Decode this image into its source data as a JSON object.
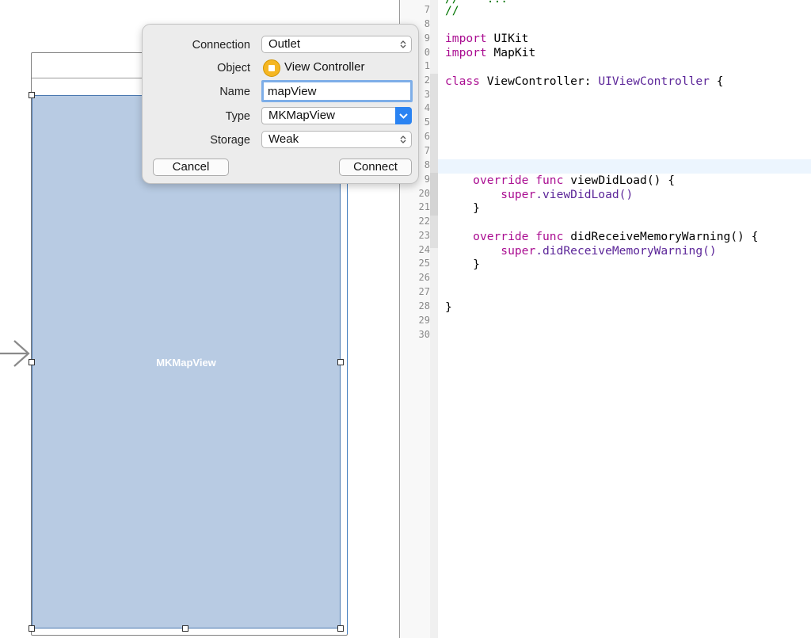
{
  "storyboard": {
    "map_view_label": "MKMapView"
  },
  "popover": {
    "connection": {
      "label": "Connection",
      "value": "Outlet"
    },
    "object": {
      "label": "Object",
      "value": "View Controller",
      "icon": "view-controller-icon"
    },
    "name": {
      "label": "Name",
      "value": "mapView"
    },
    "type": {
      "label": "Type",
      "value": "MKMapView"
    },
    "storage": {
      "label": "Storage",
      "value": "Weak"
    },
    "cancel_label": "Cancel",
    "connect_label": "Connect"
  },
  "editor": {
    "line_numbers": [
      "7",
      "8",
      "9",
      "0",
      "1",
      "2",
      "3",
      "4",
      "5",
      "6",
      "7",
      "8",
      "9",
      "20",
      "21",
      "22",
      "23",
      "24",
      "25",
      "26",
      "27",
      "28",
      "29",
      "30"
    ],
    "code": {
      "top_partial": "//    ...",
      "comment": "//",
      "import1_kw": "import",
      "import1_mod": "UIKit",
      "import2_kw": "import",
      "import2_mod": "MapKit",
      "class_kw": "class",
      "class_name": "ViewController:",
      "class_super": "UIViewController",
      "class_brace": "{",
      "override1_kw": "override func",
      "override1_rest": "viewDidLoad() {",
      "super1_kw": "super",
      "super1_rest": ".viewDidLoad()",
      "close1": "}",
      "override2_kw": "override func",
      "override2_rest": "didReceiveMemoryWarning() {",
      "super2_kw": "super",
      "super2_rest": ".didReceiveMemoryWarning()",
      "close2": "}",
      "class_close": "}"
    }
  },
  "colors": {
    "keyword": "#aa0d91",
    "type": "#5c2699",
    "comment": "#007400",
    "map_fill": "#b8cbe3",
    "accent": "#2a83f2"
  }
}
